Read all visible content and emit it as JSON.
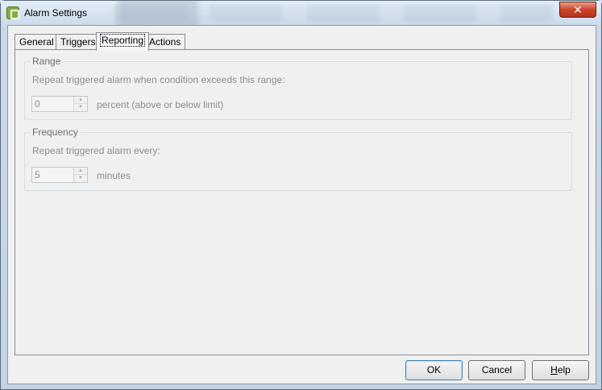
{
  "window": {
    "title": "Alarm Settings",
    "close_label": "✕"
  },
  "tabs": [
    {
      "label": "General",
      "active": false
    },
    {
      "label": "Triggers",
      "active": false
    },
    {
      "label": "Reporting",
      "active": true
    },
    {
      "label": "Actions",
      "active": false
    }
  ],
  "range": {
    "legend": "Range",
    "description": "Repeat triggered alarm when condition exceeds this range:",
    "value": "0",
    "unit": "percent (above or below limit)"
  },
  "frequency": {
    "legend": "Frequency",
    "description": "Repeat triggered alarm every:",
    "value": "5",
    "unit": "minutes"
  },
  "buttons": {
    "ok": "OK",
    "cancel": "Cancel",
    "help_first": "H",
    "help_rest": "elp"
  },
  "icons": {
    "app": "vsphere-app-icon",
    "close": "close-icon",
    "spin_up": "spin-up-icon",
    "spin_down": "spin-down-icon"
  }
}
